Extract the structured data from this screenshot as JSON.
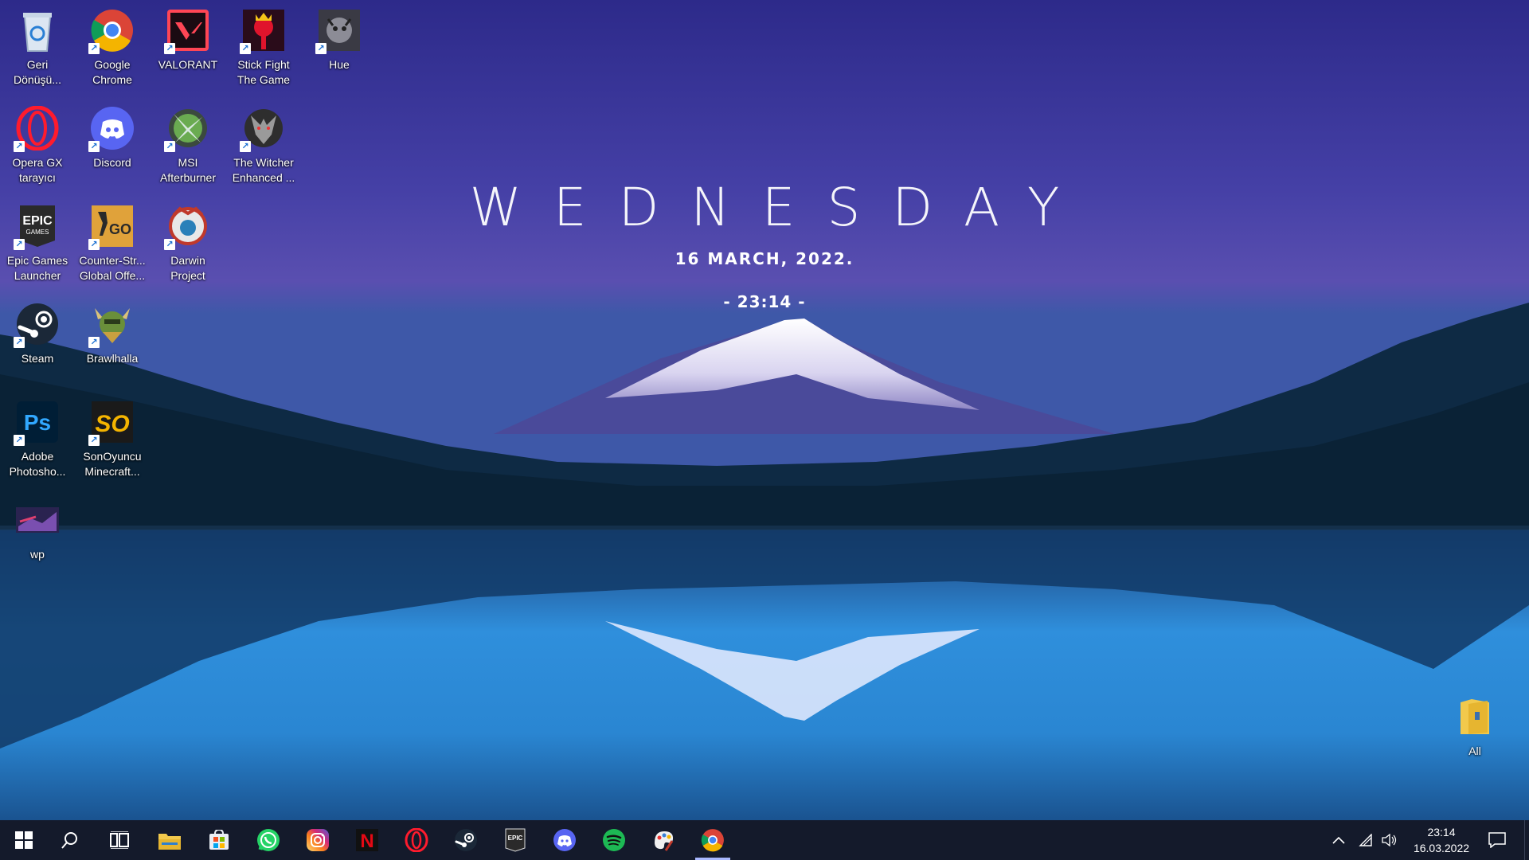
{
  "wallpaper_widget": {
    "day": "WEDNESDAY",
    "date": "16 MARCH, 2022.",
    "time": "- 23:14 -"
  },
  "desktop_icons": [
    {
      "label": "Geri\nDönüşü...",
      "icon": "recycle-bin-icon"
    },
    {
      "label": "Google\nChrome",
      "icon": "chrome-icon"
    },
    {
      "label": "VALORANT",
      "icon": "valorant-icon"
    },
    {
      "label": "Stick Fight\nThe Game",
      "icon": "stick-fight-icon"
    },
    {
      "label": "Hue",
      "icon": "hue-icon"
    },
    {
      "label": "Opera GX\ntarayıcı",
      "icon": "opera-gx-icon"
    },
    {
      "label": "Discord",
      "icon": "discord-icon"
    },
    {
      "label": "MSI\nAfterburner",
      "icon": "msi-afterburner-icon"
    },
    {
      "label": "The Witcher\nEnhanced ...",
      "icon": "witcher-icon"
    },
    {
      "label": "Epic Games\nLauncher",
      "icon": "epic-games-icon"
    },
    {
      "label": "Counter-Str...\nGlobal Offe...",
      "icon": "csgo-icon"
    },
    {
      "label": "Darwin\nProject",
      "icon": "darwin-project-icon"
    },
    {
      "label": "Steam",
      "icon": "steam-icon"
    },
    {
      "label": "Brawlhalla",
      "icon": "brawlhalla-icon"
    },
    {
      "label": "Adobe\nPhotosho...",
      "icon": "photoshop-icon"
    },
    {
      "label": "SonOyuncu\nMinecraft...",
      "icon": "sonoyuncu-icon"
    },
    {
      "label": "wp",
      "icon": "wp-image-icon"
    },
    {
      "label": "All",
      "icon": "folder-icon"
    }
  ],
  "icon_glyphs": {
    "epic": "EPIC",
    "games": "GAMES",
    "go": "GO",
    "ps": "Ps",
    "so": "SO"
  },
  "taskbar": {
    "items": [
      {
        "name": "start",
        "icon": "windows-start-icon"
      },
      {
        "name": "search",
        "icon": "search-icon"
      },
      {
        "name": "task-view",
        "icon": "task-view-icon"
      },
      {
        "name": "file-explorer",
        "icon": "file-explorer-icon"
      },
      {
        "name": "microsoft-store",
        "icon": "store-icon"
      },
      {
        "name": "whatsapp",
        "icon": "whatsapp-icon"
      },
      {
        "name": "instagram",
        "icon": "instagram-icon"
      },
      {
        "name": "netflix",
        "icon": "netflix-icon"
      },
      {
        "name": "opera-gx",
        "icon": "opera-gx-icon"
      },
      {
        "name": "steam",
        "icon": "steam-icon"
      },
      {
        "name": "epic-games",
        "icon": "epic-games-icon"
      },
      {
        "name": "discord",
        "icon": "discord-icon"
      },
      {
        "name": "spotify",
        "icon": "spotify-icon"
      },
      {
        "name": "paint",
        "icon": "paint-icon"
      },
      {
        "name": "chrome",
        "icon": "chrome-icon",
        "active": true
      }
    ],
    "netflix_glyph": "N",
    "epic_glyph": "EPIC",
    "tray": {
      "time": "23:14",
      "date": "16.03.2022"
    }
  },
  "colors": {
    "taskbar_bg": "#141a2b",
    "active_indicator": "#a9b8ff",
    "discord": "#5865f2",
    "spotify": "#1db954",
    "netflix": "#e50914",
    "whatsapp": "#25d366",
    "opera": "#ff1b2d"
  }
}
